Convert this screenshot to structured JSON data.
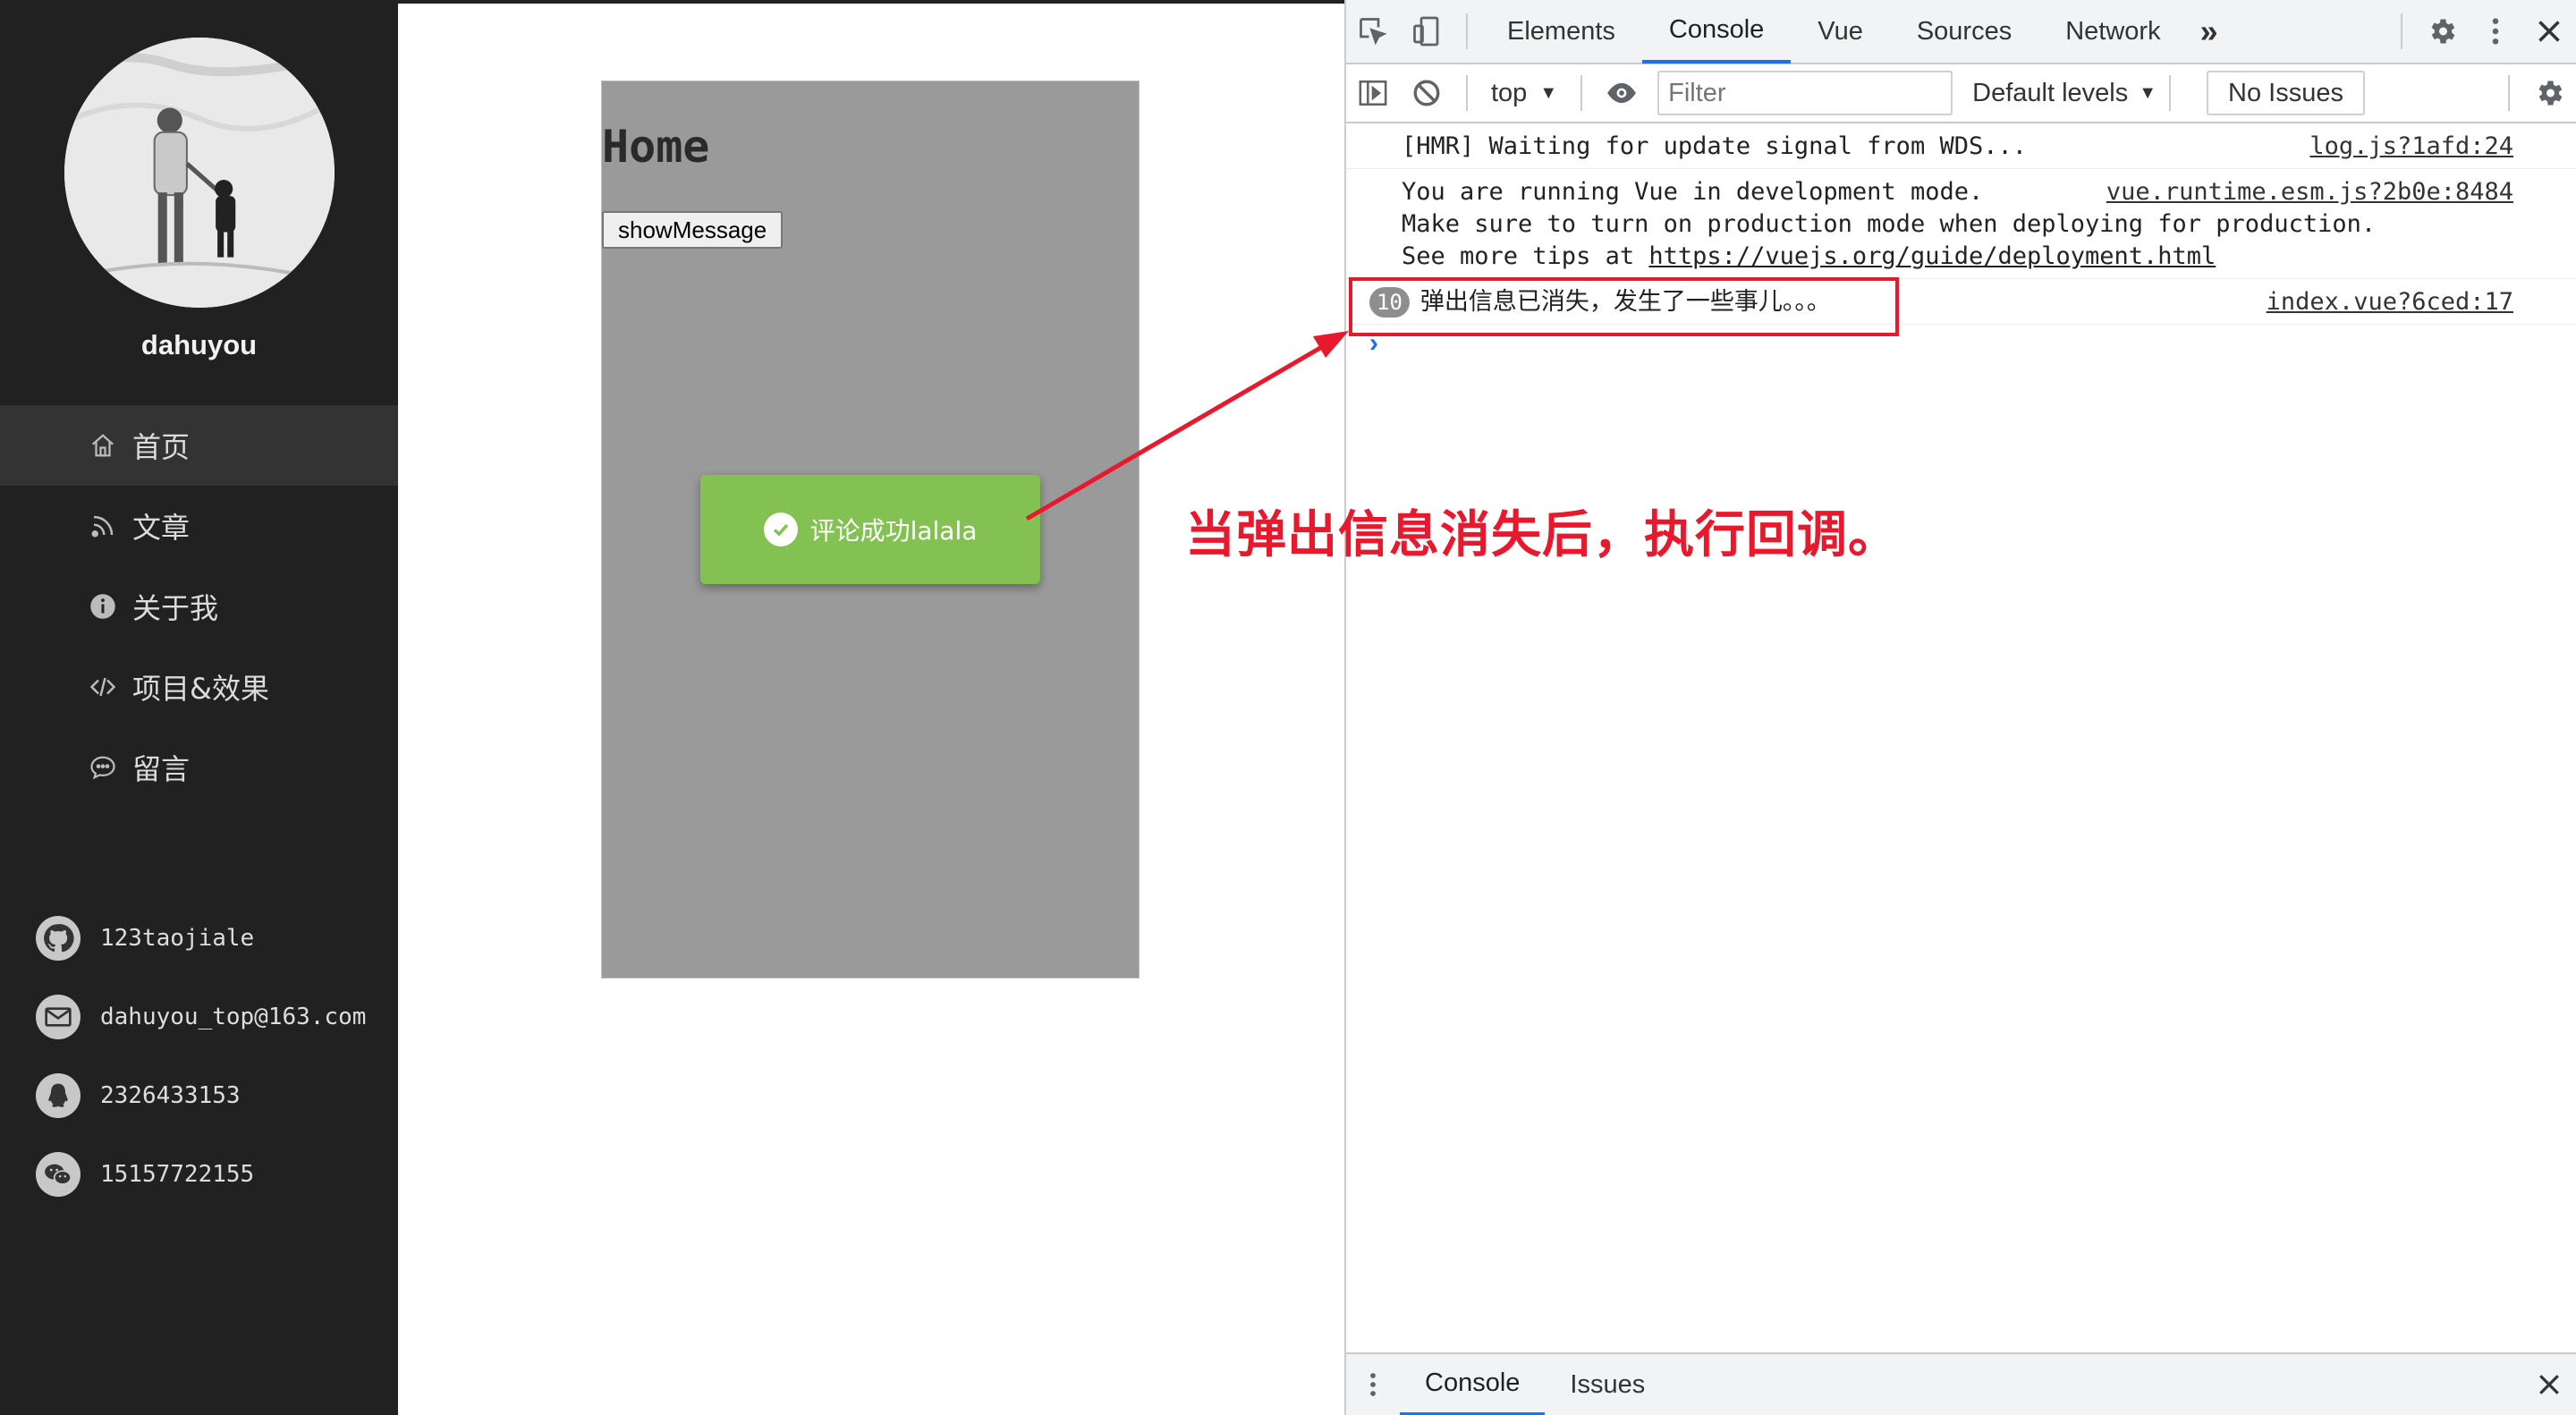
{
  "sidebar": {
    "username": "dahuyou",
    "menu": [
      {
        "label": "首页",
        "icon": "home-icon"
      },
      {
        "label": "文章",
        "icon": "rss-icon"
      },
      {
        "label": "关于我",
        "icon": "info-icon"
      },
      {
        "label": "项目&效果",
        "icon": "code-icon"
      },
      {
        "label": "留言",
        "icon": "chat-icon"
      }
    ],
    "contacts": [
      {
        "text": "123taojiale",
        "icon": "github-icon"
      },
      {
        "text": "dahuyou_top@163.com",
        "icon": "mail-icon"
      },
      {
        "text": "2326433153",
        "icon": "qq-icon"
      },
      {
        "text": "15157722155",
        "icon": "wechat-icon"
      }
    ]
  },
  "page": {
    "title": "Home",
    "button": "showMessage",
    "toast": "评论成功lalala"
  },
  "annotation": {
    "text": "当弹出信息消失后，执行回调。",
    "color": "#e8192c"
  },
  "devtools": {
    "tabs": [
      "Elements",
      "Console",
      "Vue",
      "Sources",
      "Network"
    ],
    "active_tab": "Console",
    "more": "»",
    "context": "top",
    "filter_placeholder": "Filter",
    "levels": "Default levels",
    "no_issues": "No Issues",
    "logs": [
      {
        "lines": [
          "[HMR] Waiting for update signal from WDS..."
        ],
        "source": "log.js?1afd:24"
      },
      {
        "lines": [
          "You are running Vue in development mode.",
          "Make sure to turn on production mode when deploying for production."
        ],
        "link_prefix": "See more tips at ",
        "link": "https://vuejs.org/guide/deployment.html",
        "source": "vue.runtime.esm.js?2b0e:8484"
      },
      {
        "count": "10",
        "lines": [
          "弹出信息已消失，发生了一些事儿。。。"
        ],
        "source": "index.vue?6ced:17"
      }
    ],
    "prompt": "›",
    "bottom_tabs": [
      "Console",
      "Issues"
    ]
  }
}
